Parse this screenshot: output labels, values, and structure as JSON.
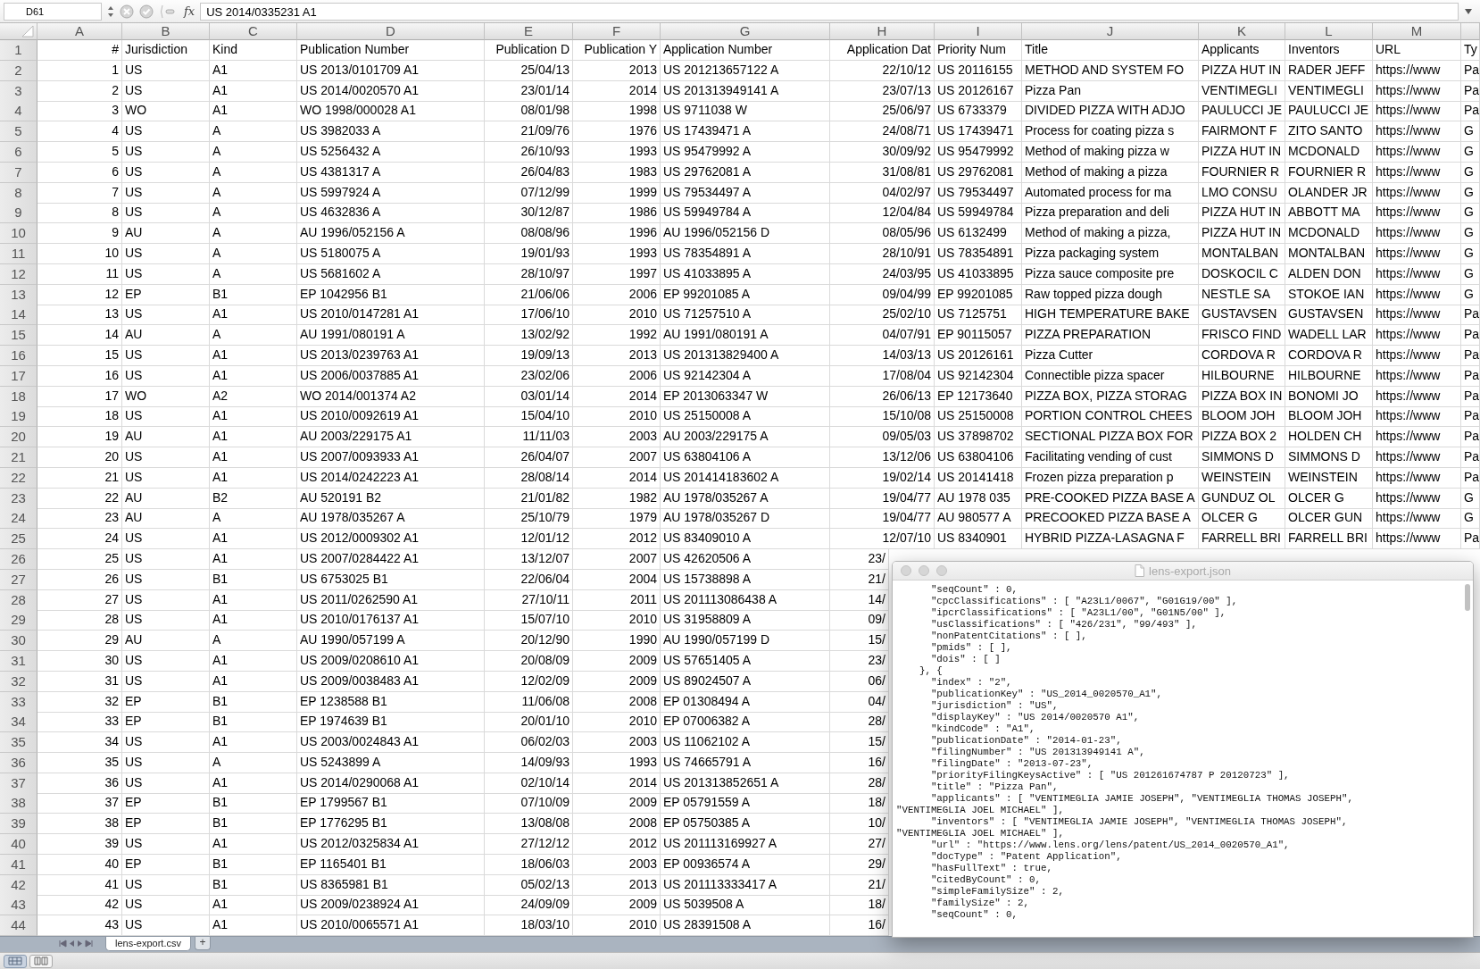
{
  "formula_bar": {
    "cell_reference": "D61",
    "function_label": "fx",
    "value": "US 2014/0335231 A1"
  },
  "sheet": {
    "columns": [
      "A",
      "B",
      "C",
      "D",
      "E",
      "F",
      "G",
      "H",
      "I",
      "J",
      "K",
      "L",
      "M"
    ],
    "rows": [
      {
        "number": "1",
        "cells": [
          "#",
          "Jurisdiction",
          "Kind",
          "Publication Number",
          "Publication D",
          "Publication Y",
          "Application Number",
          "Application Dat",
          "Priority Num",
          "Title",
          "Applicants",
          "Inventors",
          "URL",
          "Ty"
        ]
      },
      {
        "number": "2",
        "cells": [
          "1",
          "US",
          "A1",
          "US 2013/0101709 A1",
          "25/04/13",
          "2013",
          "US 201213657122 A",
          "22/10/12",
          "US 20116155",
          "METHOD AND SYSTEM FO",
          "PIZZA HUT IN",
          "RADER JEFF",
          "https://www",
          "Pa"
        ]
      },
      {
        "number": "3",
        "cells": [
          "2",
          "US",
          "A1",
          "US 2014/0020570 A1",
          "23/01/14",
          "2014",
          "US 201313949141 A",
          "23/07/13",
          "US 20126167",
          "Pizza Pan",
          "VENTIMEGLI",
          "VENTIMEGLI",
          "https://www",
          "Pa"
        ]
      },
      {
        "number": "4",
        "cells": [
          "3",
          "WO",
          "A1",
          "WO 1998/000028 A1",
          "08/01/98",
          "1998",
          "US 9711038 W",
          "25/06/97",
          "US 6733379",
          "DIVIDED PIZZA WITH ADJO",
          "PAULUCCI JE",
          "PAULUCCI JE",
          "https://www",
          "Pa"
        ]
      },
      {
        "number": "5",
        "cells": [
          "4",
          "US",
          "A",
          "US 3982033 A",
          "21/09/76",
          "1976",
          "US 17439471 A",
          "24/08/71",
          "US 17439471",
          "Process for coating pizza s",
          "FAIRMONT F",
          "ZITO SANTO",
          "https://www",
          "G"
        ]
      },
      {
        "number": "6",
        "cells": [
          "5",
          "US",
          "A",
          "US 5256432 A",
          "26/10/93",
          "1993",
          "US 95479992 A",
          "30/09/92",
          "US 95479992",
          "Method of making pizza w",
          "PIZZA HUT IN",
          "MCDONALD",
          "https://www",
          "G"
        ]
      },
      {
        "number": "7",
        "cells": [
          "6",
          "US",
          "A",
          "US 4381317 A",
          "26/04/83",
          "1983",
          "US 29762081 A",
          "31/08/81",
          "US 29762081",
          "Method of making a pizza",
          "FOURNIER R",
          "FOURNIER R",
          "https://www",
          "G"
        ]
      },
      {
        "number": "8",
        "cells": [
          "7",
          "US",
          "A",
          "US 5997924 A",
          "07/12/99",
          "1999",
          "US 79534497 A",
          "04/02/97",
          "US 79534497",
          "Automated process for ma",
          "LMO CONSU",
          "OLANDER JR",
          "https://www",
          "G"
        ]
      },
      {
        "number": "9",
        "cells": [
          "8",
          "US",
          "A",
          "US 4632836 A",
          "30/12/87",
          "1986",
          "US 59949784 A",
          "12/04/84",
          "US 59949784",
          "Pizza preparation and deli",
          "PIZZA HUT IN",
          "ABBOTT MA",
          "https://www",
          "G"
        ]
      },
      {
        "number": "10",
        "cells": [
          "9",
          "AU",
          "A",
          "AU 1996/052156 A",
          "08/08/96",
          "1996",
          "AU 1996/052156 D",
          "08/05/96",
          "US 6132499",
          "Method of making a pizza,",
          "PIZZA HUT IN",
          "MCDONALD",
          "https://www",
          "G"
        ]
      },
      {
        "number": "11",
        "cells": [
          "10",
          "US",
          "A",
          "US 5180075 A",
          "19/01/93",
          "1993",
          "US 78354891 A",
          "28/10/91",
          "US 78354891",
          "Pizza packaging system",
          "MONTALBAN",
          "MONTALBAN",
          "https://www",
          "G"
        ]
      },
      {
        "number": "12",
        "cells": [
          "11",
          "US",
          "A",
          "US 5681602 A",
          "28/10/97",
          "1997",
          "US 41033895 A",
          "24/03/95",
          "US 41033895",
          "Pizza sauce composite pre",
          "DOSKOCIL C",
          "ALDEN DON",
          "https://www",
          "G"
        ]
      },
      {
        "number": "13",
        "cells": [
          "12",
          "EP",
          "B1",
          "EP 1042956 B1",
          "21/06/06",
          "2006",
          "EP 99201085 A",
          "09/04/99",
          "EP 99201085",
          "Raw topped pizza dough",
          "NESTLE SA",
          "STOKOE IAN",
          "https://www",
          "G"
        ]
      },
      {
        "number": "14",
        "cells": [
          "13",
          "US",
          "A1",
          "US 2010/0147281 A1",
          "17/06/10",
          "2010",
          "US 71257510 A",
          "25/02/10",
          "US 7125751",
          "HIGH TEMPERATURE BAKE",
          "GUSTAVSEN",
          "GUSTAVSEN",
          "https://www",
          "Pa"
        ]
      },
      {
        "number": "15",
        "cells": [
          "14",
          "AU",
          "A",
          "AU 1991/080191 A",
          "13/02/92",
          "1992",
          "AU 1991/080191 A",
          "04/07/91",
          "EP 90115057",
          "PIZZA PREPARATION",
          "FRISCO FIND",
          "WADELL LAR",
          "https://www",
          "Pa"
        ]
      },
      {
        "number": "16",
        "cells": [
          "15",
          "US",
          "A1",
          "US 2013/0239763 A1",
          "19/09/13",
          "2013",
          "US 201313829400 A",
          "14/03/13",
          "US 20126161",
          "Pizza Cutter",
          "CORDOVA R",
          "CORDOVA R",
          "https://www",
          "Pa"
        ]
      },
      {
        "number": "17",
        "cells": [
          "16",
          "US",
          "A1",
          "US 2006/0037885 A1",
          "23/02/06",
          "2006",
          "US 92142304 A",
          "17/08/04",
          "US 92142304",
          "Connectible pizza spacer",
          "HILBOURNE",
          "HILBOURNE",
          "https://www",
          "Pa"
        ]
      },
      {
        "number": "18",
        "cells": [
          "17",
          "WO",
          "A2",
          "WO 2014/001374 A2",
          "03/01/14",
          "2014",
          "EP 2013063347 W",
          "26/06/13",
          "EP 12173640",
          "PIZZA BOX, PIZZA STORAG",
          "PIZZA BOX IN",
          "BONOMI JO",
          "https://www",
          "Pa"
        ]
      },
      {
        "number": "19",
        "cells": [
          "18",
          "US",
          "A1",
          "US 2010/0092619 A1",
          "15/04/10",
          "2010",
          "US 25150008 A",
          "15/10/08",
          "US 25150008",
          "PORTION CONTROL CHEES",
          "BLOOM JOH",
          "BLOOM JOH",
          "https://www",
          "Pa"
        ]
      },
      {
        "number": "20",
        "cells": [
          "19",
          "AU",
          "A1",
          "AU 2003/229175 A1",
          "11/11/03",
          "2003",
          "AU 2003/229175 A",
          "09/05/03",
          "US 37898702",
          "SECTIONAL PIZZA BOX FOR",
          "PIZZA BOX 2",
          "HOLDEN CH",
          "https://www",
          "Pa"
        ]
      },
      {
        "number": "21",
        "cells": [
          "20",
          "US",
          "A1",
          "US 2007/0093933 A1",
          "26/04/07",
          "2007",
          "US 63804106 A",
          "13/12/06",
          "US 63804106",
          "Facilitating vending of cust",
          "SIMMONS D",
          "SIMMONS D",
          "https://www",
          "Pa"
        ]
      },
      {
        "number": "22",
        "cells": [
          "21",
          "US",
          "A1",
          "US 2014/0242223 A1",
          "28/08/14",
          "2014",
          "US 201414183602 A",
          "19/02/14",
          "US 20141418",
          "Frozen pizza preparation p",
          "WEINSTEIN",
          "WEINSTEIN",
          "https://www",
          "Pa"
        ]
      },
      {
        "number": "23",
        "cells": [
          "22",
          "AU",
          "B2",
          "AU 520191 B2",
          "21/01/82",
          "1982",
          "AU 1978/035267 A",
          "19/04/77",
          "AU 1978 035",
          "PRE-COOKED PIZZA BASE A",
          "GUNDUZ OL",
          "OLCER G",
          "https://www",
          "G"
        ]
      },
      {
        "number": "24",
        "cells": [
          "23",
          "AU",
          "A",
          "AU 1978/035267 A",
          "25/10/79",
          "1979",
          "AU 1978/035267 D",
          "19/04/77",
          "AU 980577 A",
          "PRECOOKED PIZZA BASE A",
          "OLCER G",
          "OLCER GUN",
          "https://www",
          "G"
        ]
      },
      {
        "number": "25",
        "cells": [
          "24",
          "US",
          "A1",
          "US 2012/0009302 A1",
          "12/01/12",
          "2012",
          "US 83409010 A",
          "12/07/10",
          "US 8340901",
          "HYBRID PIZZA-LASAGNA F",
          "FARRELL BRI",
          "FARRELL BRI",
          "https://www",
          "Pa"
        ]
      },
      {
        "number": "26",
        "cells": [
          "25",
          "US",
          "A1",
          "US 2007/0284422 A1",
          "13/12/07",
          "2007",
          "US 42620506 A",
          "23/"
        ]
      },
      {
        "number": "27",
        "cells": [
          "26",
          "US",
          "B1",
          "US 6753025 B1",
          "22/06/04",
          "2004",
          "US 15738898 A",
          "21/"
        ]
      },
      {
        "number": "28",
        "cells": [
          "27",
          "US",
          "A1",
          "US 2011/0262590 A1",
          "27/10/11",
          "2011",
          "US 201113086438 A",
          "14/"
        ]
      },
      {
        "number": "29",
        "cells": [
          "28",
          "US",
          "A1",
          "US 2010/0176137 A1",
          "15/07/10",
          "2010",
          "US 31958809 A",
          "09/"
        ]
      },
      {
        "number": "30",
        "cells": [
          "29",
          "AU",
          "A",
          "AU 1990/057199 A",
          "20/12/90",
          "1990",
          "AU 1990/057199 D",
          "15/"
        ]
      },
      {
        "number": "31",
        "cells": [
          "30",
          "US",
          "A1",
          "US 2009/0208610 A1",
          "20/08/09",
          "2009",
          "US 57651405 A",
          "23/"
        ]
      },
      {
        "number": "32",
        "cells": [
          "31",
          "US",
          "A1",
          "US 2009/0038483 A1",
          "12/02/09",
          "2009",
          "US 89024507 A",
          "06/"
        ]
      },
      {
        "number": "33",
        "cells": [
          "32",
          "EP",
          "B1",
          "EP 1238588 B1",
          "11/06/08",
          "2008",
          "EP 01308494 A",
          "04/"
        ]
      },
      {
        "number": "34",
        "cells": [
          "33",
          "EP",
          "B1",
          "EP 1974639 B1",
          "20/01/10",
          "2010",
          "EP 07006382 A",
          "28/"
        ]
      },
      {
        "number": "35",
        "cells": [
          "34",
          "US",
          "A1",
          "US 2003/0024843 A1",
          "06/02/03",
          "2003",
          "US 11062102 A",
          "15/"
        ]
      },
      {
        "number": "36",
        "cells": [
          "35",
          "US",
          "A",
          "US 5243899 A",
          "14/09/93",
          "1993",
          "US 74665791 A",
          "16/"
        ]
      },
      {
        "number": "37",
        "cells": [
          "36",
          "US",
          "A1",
          "US 2014/0290068 A1",
          "02/10/14",
          "2014",
          "US 201313852651 A",
          "28/"
        ]
      },
      {
        "number": "38",
        "cells": [
          "37",
          "EP",
          "B1",
          "EP 1799567 B1",
          "07/10/09",
          "2009",
          "EP 05791559 A",
          "18/"
        ]
      },
      {
        "number": "39",
        "cells": [
          "38",
          "EP",
          "B1",
          "EP 1776295 B1",
          "13/08/08",
          "2008",
          "EP 05750385 A",
          "10/"
        ]
      },
      {
        "number": "40",
        "cells": [
          "39",
          "US",
          "A1",
          "US 2012/0325834 A1",
          "27/12/12",
          "2012",
          "US 201113169927 A",
          "27/"
        ]
      },
      {
        "number": "41",
        "cells": [
          "40",
          "EP",
          "B1",
          "EP 1165401 B1",
          "18/06/03",
          "2003",
          "EP 00936574 A",
          "29/"
        ]
      },
      {
        "number": "42",
        "cells": [
          "41",
          "US",
          "B1",
          "US 8365981 B1",
          "05/02/13",
          "2013",
          "US 201113333417 A",
          "21/"
        ]
      },
      {
        "number": "43",
        "cells": [
          "42",
          "US",
          "A1",
          "US 2009/0238924 A1",
          "24/09/09",
          "2009",
          "US 5039508 A",
          "18/"
        ]
      },
      {
        "number": "44",
        "cells": [
          "43",
          "US",
          "A1",
          "US 2010/0065571 A1",
          "18/03/10",
          "2010",
          "US 28391508 A",
          "16/"
        ]
      }
    ]
  },
  "text_window": {
    "title": "lens-export.json",
    "lines": [
      "      \"seqCount\" : 0,",
      "      \"cpcClassifications\" : [ \"A23L1/0067\", \"G01G19/00\" ],",
      "      \"ipcrClassifications\" : [ \"A23L1/00\", \"G01N5/00\" ],",
      "      \"usClassifications\" : [ \"426/231\", \"99/493\" ],",
      "      \"nonPatentCitations\" : [ ],",
      "      \"pmids\" : [ ],",
      "      \"dois\" : [ ]",
      "    }, {",
      "      \"index\" : \"2\",",
      "      \"publicationKey\" : \"US_2014_0020570_A1\",",
      "      \"jurisdiction\" : \"US\",",
      "      \"displayKey\" : \"US 2014/0020570 A1\",",
      "      \"kindCode\" : \"A1\",",
      "      \"publicationDate\" : \"2014-01-23\",",
      "      \"filingNumber\" : \"US 201313949141 A\",",
      "      \"filingDate\" : \"2013-07-23\",",
      "      \"priorityFilingKeysActive\" : [ \"US 201261674787 P 20120723\" ],",
      "      \"title\" : \"Pizza Pan\",",
      "      \"applicants\" : [ \"VENTIMEGLIA JAMIE JOSEPH\", \"VENTIMEGLIA THOMAS JOSEPH\",",
      "\"VENTIMEGLIA JOEL MICHAEL\" ],",
      "      \"inventors\" : [ \"VENTIMEGLIA JAMIE JOSEPH\", \"VENTIMEGLIA THOMAS JOSEPH\",",
      "\"VENTIMEGLIA JOEL MICHAEL\" ],",
      "      \"url\" : \"https://www.lens.org/lens/patent/US_2014_0020570_A1\",",
      "      \"docType\" : \"Patent Application\",",
      "      \"hasFullText\" : true,",
      "      \"citedByCount\" : 0,",
      "      \"simpleFamilySize\" : 2,",
      "      \"familySize\" : 2,",
      "      \"seqCount\" : 0,"
    ]
  },
  "sheet_tabs": {
    "tabs": [
      {
        "label": "lens-export.csv",
        "selected": true
      }
    ],
    "add_label": "+"
  },
  "status_bar": {
    "view_buttons": [
      {
        "kind": "normal",
        "selected": true
      },
      {
        "kind": "page_layout",
        "selected": false
      }
    ]
  }
}
